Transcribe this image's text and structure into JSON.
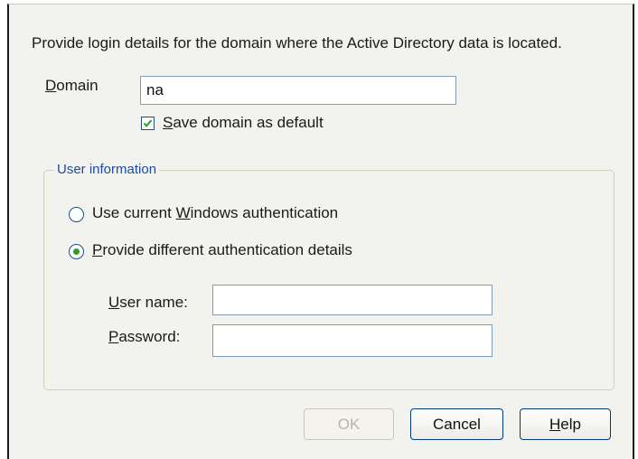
{
  "intro_text": "Provide login details for the domain where the Active Directory data is located.",
  "domain": {
    "label_first": "D",
    "label_rest": "omain",
    "value": "na"
  },
  "save_default": {
    "checked": true,
    "label_first": "S",
    "label_rest": "ave domain as default"
  },
  "user_info": {
    "title": "User information",
    "radio_current": {
      "selected": false,
      "label_pre": "Use current ",
      "label_accel": "W",
      "label_post": "indows authentication"
    },
    "radio_different": {
      "selected": true,
      "label_accel": "P",
      "label_post": "rovide different authentication details"
    },
    "username": {
      "label_accel": "U",
      "label_post": "ser name:",
      "value": ""
    },
    "password": {
      "label_accel": "P",
      "label_post": "assword:",
      "value": ""
    }
  },
  "buttons": {
    "ok": "OK",
    "cancel": "Cancel",
    "help_accel": "H",
    "help_post": "elp"
  },
  "colors": {
    "group_title": "#1e4da0",
    "check_green": "#2e9a2e",
    "dialog_bg": "#f2f2ee"
  }
}
